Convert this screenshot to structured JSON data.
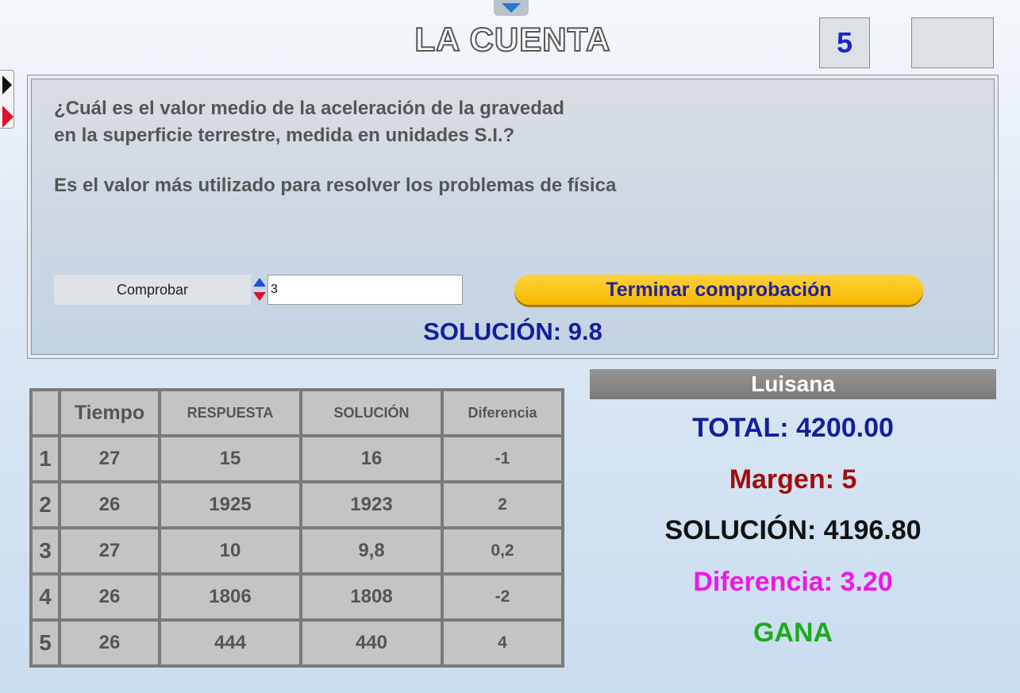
{
  "header": {
    "title": "LA CUENTA",
    "round": "5"
  },
  "question": {
    "text": "¿Cuál es el valor medio de la aceleración de la gravedad\nen la superficie terrestre, medida en unidades S.I.?",
    "hint": "Es el valor más utilizado para resolver los problemas de física",
    "check_label": "Comprobar",
    "answer_value": "3",
    "finish_label": "Terminar comprobación",
    "solution": "SOLUCIÓN: 9.8"
  },
  "table": {
    "headers": [
      "",
      "Tiempo",
      "RESPUESTA",
      "SOLUCIÓN",
      "Diferencia"
    ],
    "rows": [
      [
        "1",
        "27",
        "15",
        "16",
        "-1"
      ],
      [
        "2",
        "26",
        "1925",
        "1923",
        "2"
      ],
      [
        "3",
        "27",
        "10",
        "9,8",
        "0,2"
      ],
      [
        "4",
        "26",
        "1806",
        "1808",
        "-2"
      ],
      [
        "5",
        "26",
        "444",
        "440",
        "4"
      ]
    ]
  },
  "player": {
    "name": "Luisana",
    "total": "TOTAL: 4200.00",
    "margin": "Margen: 5",
    "solution": "SOLUCIÓN: 4196.80",
    "difference": "Diferencia: 3.20",
    "result": "GANA"
  },
  "colors": {
    "accent_blue": "#121f9c",
    "button_yellow": "#f3b800",
    "margin_red": "#a00d0d",
    "difference_magenta": "#ee17e5",
    "win_green": "#1da91d"
  },
  "icons": [
    "chevron-down-icon",
    "play-icon",
    "play-red-icon",
    "increment-icon",
    "decrement-icon"
  ]
}
